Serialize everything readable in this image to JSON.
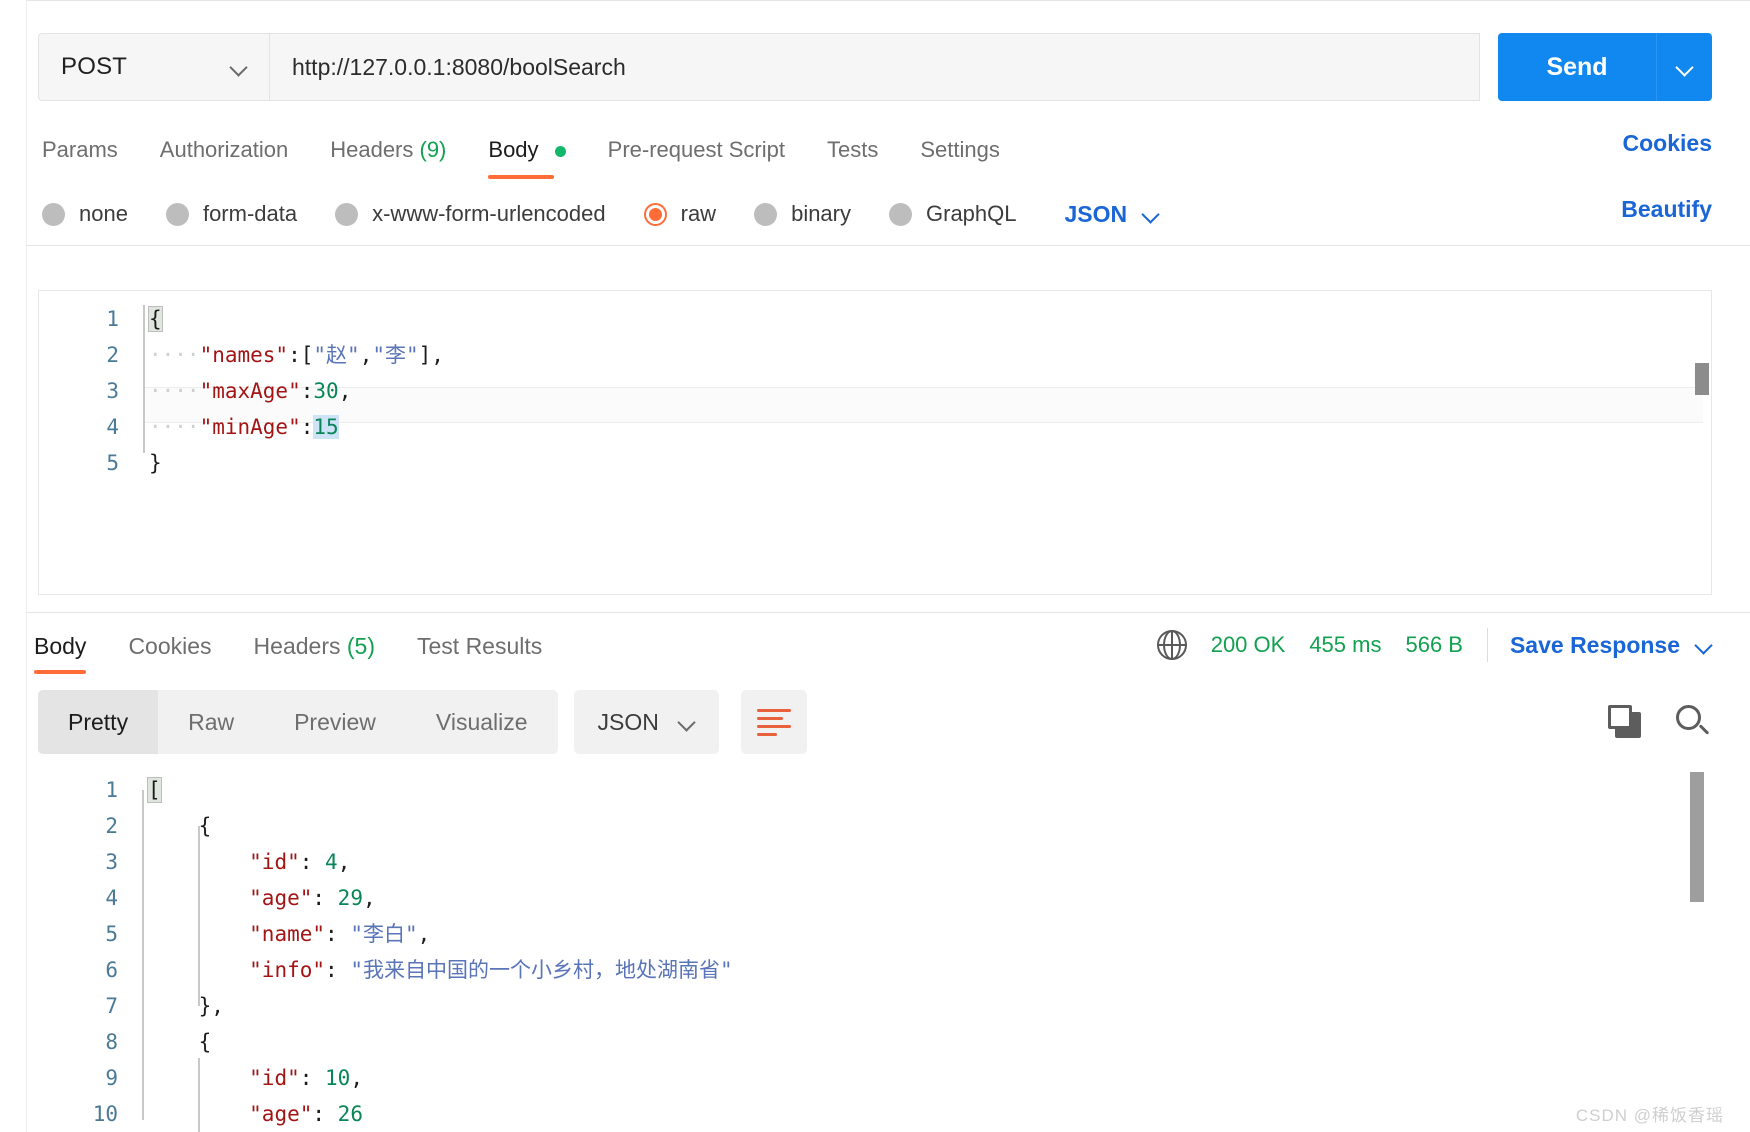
{
  "request": {
    "method": "POST",
    "url": "http://127.0.0.1:8080/boolSearch",
    "send_label": "Send",
    "tabs": [
      {
        "label": "Params",
        "count": "",
        "active": false
      },
      {
        "label": "Authorization",
        "count": "",
        "active": false
      },
      {
        "label": "Headers",
        "count": "(9)",
        "active": false
      },
      {
        "label": "Body",
        "count": "",
        "active": true
      },
      {
        "label": "Pre-request Script",
        "count": "",
        "active": false
      },
      {
        "label": "Tests",
        "count": "",
        "active": false
      },
      {
        "label": "Settings",
        "count": "",
        "active": false
      }
    ],
    "cookies_link": "Cookies",
    "beautify_link": "Beautify",
    "body_types": [
      {
        "label": "none",
        "selected": false
      },
      {
        "label": "form-data",
        "selected": false
      },
      {
        "label": "x-www-form-urlencoded",
        "selected": false
      },
      {
        "label": "raw",
        "selected": true
      },
      {
        "label": "binary",
        "selected": false
      },
      {
        "label": "GraphQL",
        "selected": false
      }
    ],
    "raw_format": "JSON",
    "body_lines": [
      {
        "n": "1",
        "text": "{"
      },
      {
        "n": "2",
        "text": "    \"names\":[\"赵\",\"李\"],"
      },
      {
        "n": "3",
        "text": "    \"maxAge\":30,"
      },
      {
        "n": "4",
        "text": "    \"minAge\":15"
      },
      {
        "n": "5",
        "text": "}"
      }
    ]
  },
  "response": {
    "tabs": [
      {
        "label": "Body",
        "count": "",
        "active": true
      },
      {
        "label": "Cookies",
        "count": "",
        "active": false
      },
      {
        "label": "Headers",
        "count": "(5)",
        "active": false
      },
      {
        "label": "Test Results",
        "count": "",
        "active": false
      }
    ],
    "status": "200 OK",
    "time": "455 ms",
    "size": "566 B",
    "save_response": "Save Response",
    "view_modes": [
      {
        "label": "Pretty",
        "active": true
      },
      {
        "label": "Raw",
        "active": false
      },
      {
        "label": "Preview",
        "active": false
      },
      {
        "label": "Visualize",
        "active": false
      }
    ],
    "format": "JSON",
    "body_lines": [
      {
        "n": "1",
        "text": "["
      },
      {
        "n": "2",
        "text": "    {"
      },
      {
        "n": "3",
        "text": "        \"id\": 4,"
      },
      {
        "n": "4",
        "text": "        \"age\": 29,"
      },
      {
        "n": "5",
        "text": "        \"name\": \"李白\","
      },
      {
        "n": "6",
        "text": "        \"info\": \"我来自中国的一个小乡村，地处湖南省\""
      },
      {
        "n": "7",
        "text": "    },"
      },
      {
        "n": "8",
        "text": "    {"
      },
      {
        "n": "9",
        "text": "        \"id\": 10,"
      },
      {
        "n": "10",
        "text": "        \"age\": 26"
      }
    ]
  },
  "watermark": "CSDN @稀饭香瑶",
  "colors": {
    "accent_orange": "#ff6c37",
    "link_blue": "#1a66d6",
    "send_blue": "#1187f0",
    "status_green": "#12a150"
  }
}
